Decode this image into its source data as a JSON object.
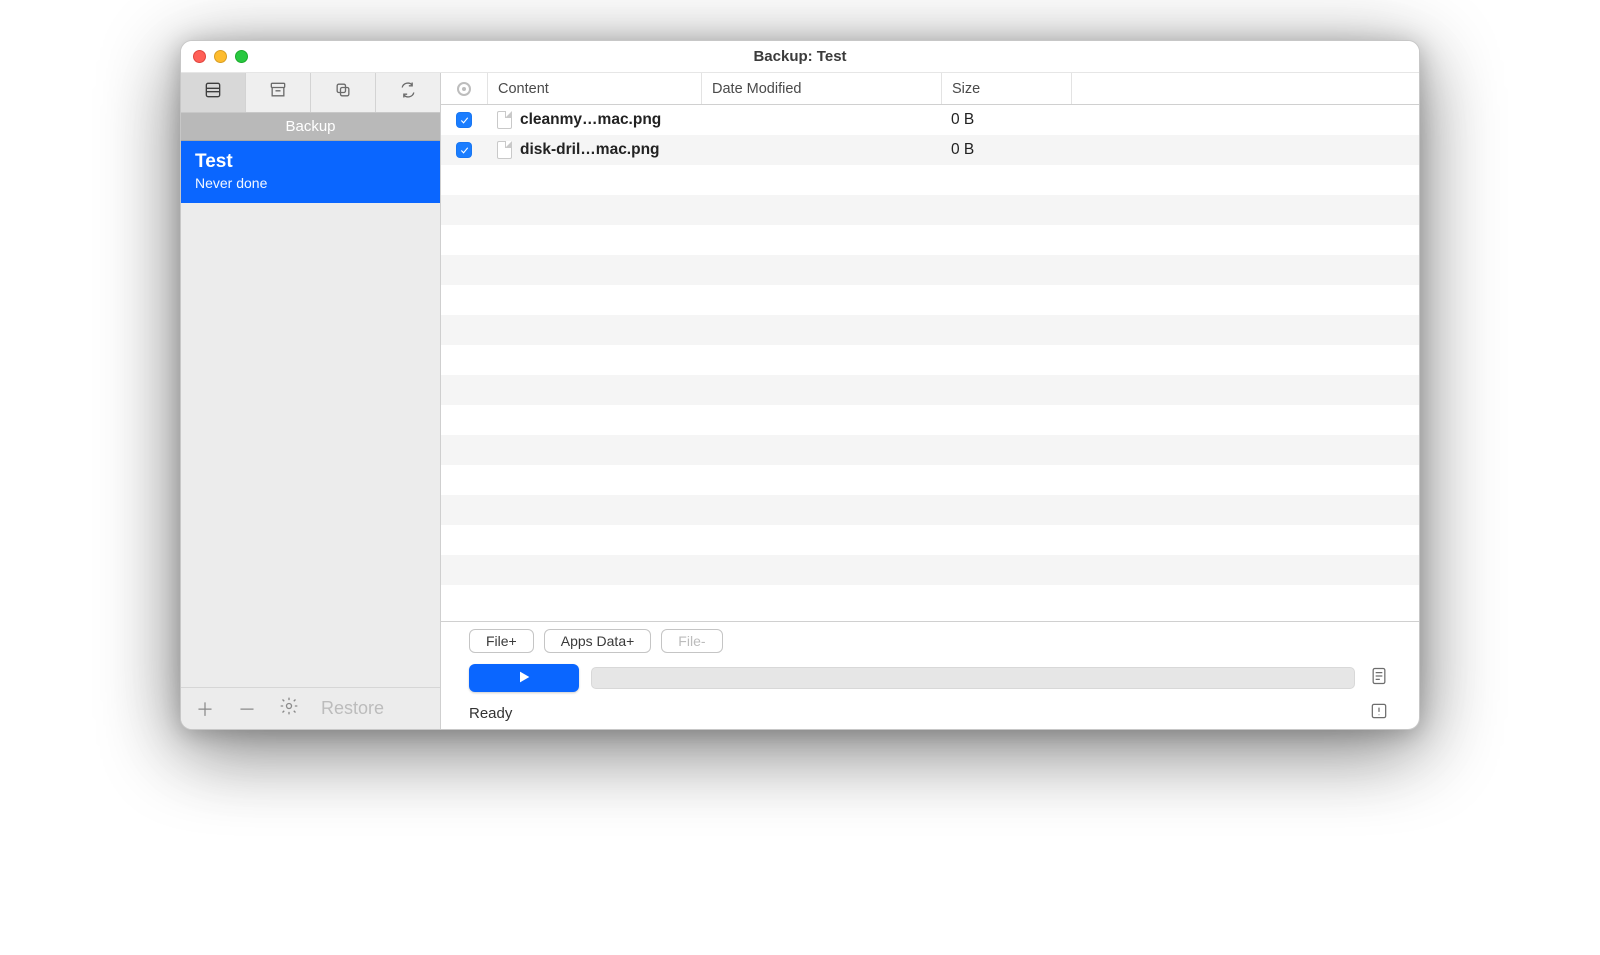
{
  "window": {
    "title": "Backup: Test"
  },
  "sidebar": {
    "header": "Backup",
    "plan": {
      "name": "Test",
      "status": "Never done"
    },
    "footer": {
      "restore_label": "Restore"
    }
  },
  "columns": {
    "content": "Content",
    "date": "Date Modified",
    "size": "Size"
  },
  "rows": [
    {
      "checked": true,
      "name": "cleanmy…mac.png",
      "date": "",
      "size": "0 B"
    },
    {
      "checked": true,
      "name": "disk-dril…mac.png",
      "date": "",
      "size": "0 B"
    }
  ],
  "buttons": {
    "file_add": "File+",
    "apps_data_add": "Apps Data+",
    "file_remove": "File-"
  },
  "status": {
    "text": "Ready"
  }
}
